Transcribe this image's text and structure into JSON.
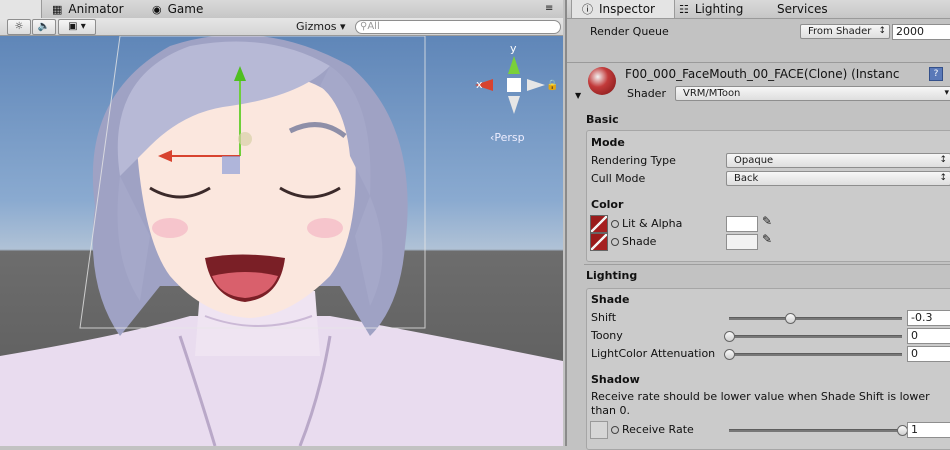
{
  "scene_tabs": {
    "scene_icon": "scene-icon",
    "animator": "Animator",
    "game": "Game"
  },
  "scene_toolbar": {
    "light_icon": "sun-icon",
    "audio_icon": "speaker-icon",
    "fx_icon": "image-icon",
    "gizmos": "Gizmos",
    "search_placeholder": "All"
  },
  "scene": {
    "persp": "‹Persp",
    "axis_y": "y",
    "axis_x": "x"
  },
  "inspector_tabs": {
    "inspector": "Inspector",
    "lighting": "Lighting",
    "services": "Services"
  },
  "render_queue": {
    "label": "Render Queue",
    "mode": "From Shader",
    "value": "2000"
  },
  "material": {
    "name": "F00_000_FaceMouth_00_FACE(Clone) (Instanc",
    "shader_label": "Shader",
    "shader": "VRM/MToon"
  },
  "basic": {
    "title": "Basic",
    "mode_title": "Mode",
    "rendering_type_label": "Rendering Type",
    "rendering_type": "Opaque",
    "cull_mode_label": "Cull Mode",
    "cull_mode": "Back",
    "color_title": "Color",
    "lit_label": "Lit & Alpha",
    "shade_label": "Shade"
  },
  "lighting": {
    "title": "Lighting",
    "shade_title": "Shade",
    "shift_label": "Shift",
    "shift_value": "-0.3",
    "shift_fraction": 0.35,
    "toony_label": "Toony",
    "toony_value": "0",
    "toony_fraction": 0.0,
    "lca_label": "LightColor Attenuation",
    "lca_value": "0",
    "lca_fraction": 0.0,
    "shadow_title": "Shadow",
    "shadow_note": "Receive rate should be lower value when Shade Shift is lower than 0.",
    "receive_label": "Receive Rate",
    "receive_value": "1",
    "receive_fraction": 1.0
  }
}
